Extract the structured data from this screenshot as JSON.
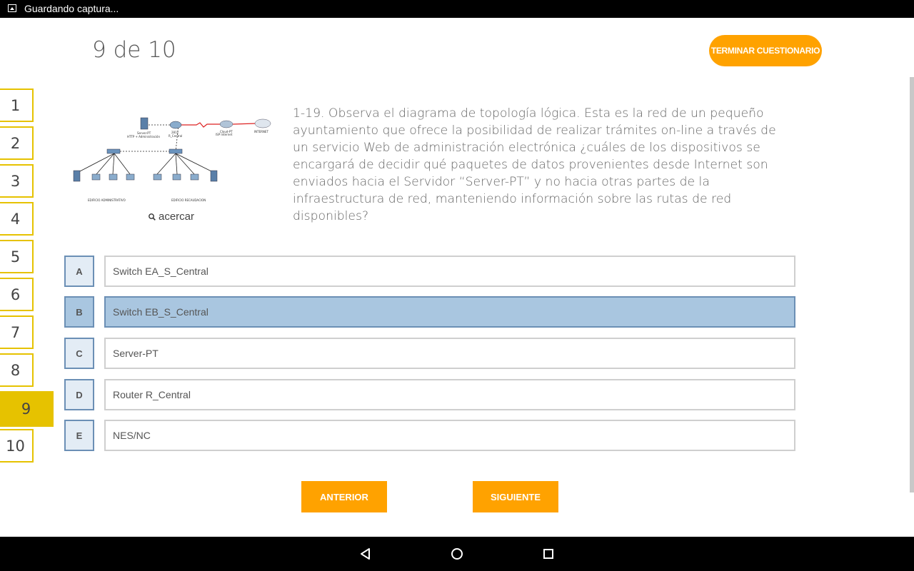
{
  "status_bar": {
    "text": "Guardando captura..."
  },
  "header": {
    "counter": "9 de 10",
    "finish_button": "TERMINAR CUESTIONARIO"
  },
  "question_nav": [
    "1",
    "2",
    "3",
    "4",
    "5",
    "6",
    "7",
    "8",
    "9",
    "10"
  ],
  "current_question": "9",
  "figure": {
    "zoom_label": "acercar",
    "labels": {
      "server_top": "Server-PT",
      "server_top2": "HTTP + Administración",
      "router": "2811",
      "router2": "R_Central",
      "cloud": "Cloud-PT",
      "cloud2": "ISP Internet",
      "internet": "INTERNET",
      "building_left": "EDIFICIO ADMINISTRATIVO",
      "building_right": "EDIFICIO RECAUDACION"
    }
  },
  "question": {
    "text": "1-19. Observa el diagrama de topología lógica. Esta es la red de un pequeño ayuntamiento que ofrece la posibilidad de realizar trámites on-line a través de un servicio Web de administración electrónica ¿cuáles de los dispositivos se encargará de decidir qué paquetes de datos provenientes desde Internet son enviados hacia el Servidor “Server-PT” y no hacia otras partes de la infraestructura de red, manteniendo información sobre las rutas de red disponibles?"
  },
  "options": [
    {
      "letter": "A",
      "text": "Switch EA_S_Central",
      "selected": false
    },
    {
      "letter": "B",
      "text": "Switch EB_S_Central",
      "selected": true
    },
    {
      "letter": "C",
      "text": "Server-PT",
      "selected": false
    },
    {
      "letter": "D",
      "text": "Router R_Central",
      "selected": false
    },
    {
      "letter": "E",
      "text": "NES/NC",
      "selected": false
    }
  ],
  "footer": {
    "prev": "ANTERIOR",
    "next": "SIGUIENTE"
  },
  "colors": {
    "accent": "#ffa200",
    "nav_yellow": "#e6c200",
    "selected": "#a9c6e0"
  }
}
